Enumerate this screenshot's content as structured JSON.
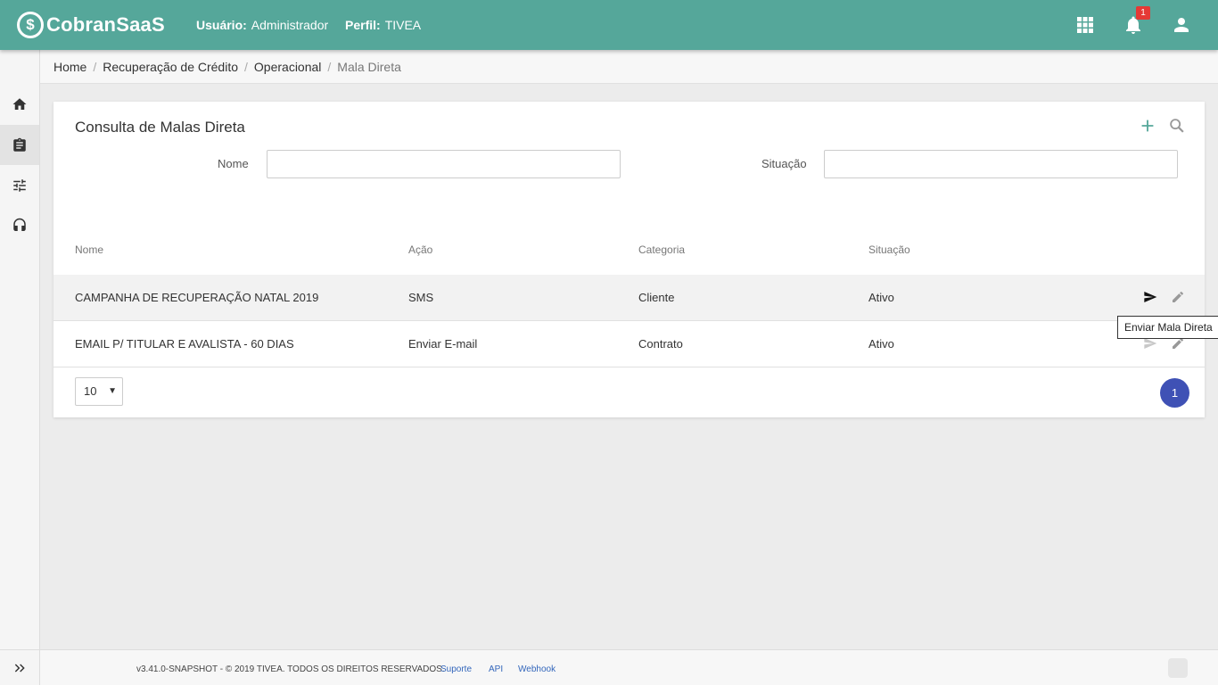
{
  "header": {
    "logo_symbol": "$",
    "logo_text": "CobranSaaS",
    "user_label": "Usuário:",
    "user_value": "Administrador",
    "profile_label": "Perfil:",
    "profile_value": "TIVEA",
    "notification_count": "1",
    "icons": [
      "apps-grid-icon",
      "bell-icon",
      "user-account-icon"
    ],
    "bg_color": "#55a79a"
  },
  "sidebar": {
    "items": [
      {
        "name": "home-icon",
        "active": false
      },
      {
        "name": "clipboard-icon",
        "active": true
      },
      {
        "name": "sliders-icon",
        "active": false
      },
      {
        "name": "headset-icon",
        "active": false
      }
    ],
    "expand_icon": "double-chevron-right-icon"
  },
  "breadcrumb": {
    "items": [
      "Home",
      "Recuperação de Crédito",
      "Operacional",
      "Mala Direta"
    ],
    "separator": "/"
  },
  "main": {
    "title": "Consulta de Malas Direta",
    "actions": [
      "add-icon",
      "search-icon"
    ],
    "filters": {
      "nome_label": "Nome",
      "nome_value": "",
      "situacao_label": "Situação",
      "situacao_value": ""
    },
    "table": {
      "columns": [
        "Nome",
        "Ação",
        "Categoria",
        "Situação"
      ],
      "rows": [
        {
          "nome": "CAMPANHA DE RECUPERAÇÃO NATAL 2019",
          "acao": "SMS",
          "categoria": "Cliente",
          "situacao": "Ativo"
        },
        {
          "nome": "EMAIL P/ TITULAR E AVALISTA - 60 DIAS",
          "acao": "Enviar E-mail",
          "categoria": "Contrato",
          "situacao": "Ativo"
        }
      ],
      "row_actions": [
        "send-icon",
        "edit-pencil-icon"
      ]
    },
    "page_size": "10",
    "current_page": "1",
    "tooltip": "Enviar Mala Direta",
    "page_accent": "#3f51b5"
  },
  "footer": {
    "copyright": "v3.41.0-SNAPSHOT - © 2019 TIVEA. TODOS OS DIREITOS RESERVADOS.",
    "links": [
      "Suporte",
      "API",
      "Webhook"
    ]
  }
}
